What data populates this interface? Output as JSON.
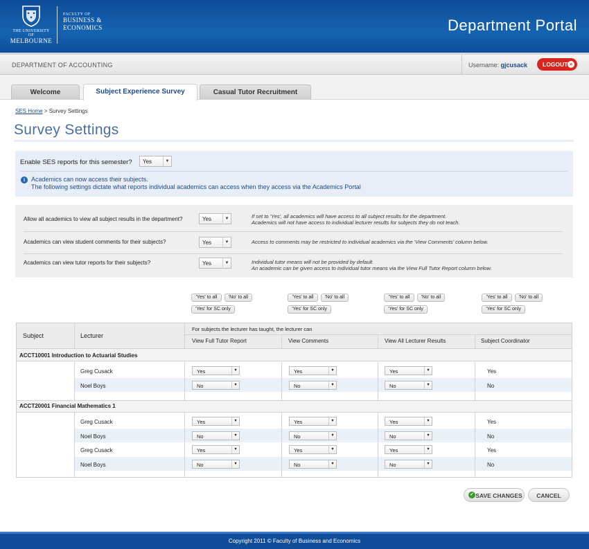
{
  "header": {
    "logo_sub": "THE UNIVERSITY OF",
    "logo_main": "MELBOURNE",
    "faculty_small": "FACULTY OF",
    "faculty_line1": "BUSINESS &",
    "faculty_line2": "ECONOMICS",
    "portal_title": "Department Portal"
  },
  "subbar": {
    "department": "DEPARTMENT OF ACCOUNTING",
    "username_label": "Username:",
    "username": "gjcusack",
    "logout_label": "LOGOUT"
  },
  "tabs": [
    {
      "label": "Welcome",
      "active": false
    },
    {
      "label": "Subject Experience Survey",
      "active": true
    },
    {
      "label": "Casual Tutor Recruitment",
      "active": false
    }
  ],
  "breadcrumb": {
    "home": "SES Home",
    "separator": " > ",
    "current": "Survey Settings"
  },
  "page_title": "Survey Settings",
  "enable": {
    "label": "Enable SES reports for this semester?",
    "value": "Yes",
    "info_line1": "Academics can now access their subjects.",
    "info_line2": "The following settings dictate what reports individual academics can access when they access via the Academics Portal"
  },
  "settings": [
    {
      "question": "Allow all academics to view all subject results in the department?",
      "value": "Yes",
      "note_line1": "If set to 'Yes', all academics will have access to all subject results for the department.",
      "note_line2": "Academics will not have access to individual lecturer results for subjects they do not teach."
    },
    {
      "question": "Academics can view student comments for their subjects?",
      "value": "Yes",
      "note_line1": "Access to comments may be restricted to individual academics via the 'View Comments' column below.",
      "note_line2": ""
    },
    {
      "question": "Academics can view tutor reports for their subjects?",
      "value": "Yes",
      "note_line1": "Individual tutor means will not be provided by default.",
      "note_line2": "An academic can be given access to individual tutor means via the View Full Tutor Report column below."
    }
  ],
  "bulk": {
    "yes_all": "'Yes' to all",
    "no_all": "'No' to all",
    "yes_sc": "'Yes' for SC only"
  },
  "table": {
    "col_subject": "Subject",
    "col_lecturer": "Lecturer",
    "group_caption": "For subjects the lecturer has taught, the lecturer can",
    "col_tutor": "View Full Tutor Report",
    "col_comments": "View Comments",
    "col_results": "View All Lecturer Results",
    "col_coordinator": "Subject Coordinator",
    "subjects": [
      {
        "name": "ACCT10001 Introduction to Actuarial Studies",
        "rows": [
          {
            "lecturer": "Greg Cusack",
            "tutor": "Yes",
            "comments": "Yes",
            "results": "Yes",
            "coordinator": "Yes"
          },
          {
            "lecturer": "Noel Boys",
            "tutor": "No",
            "comments": "No",
            "results": "No",
            "coordinator": "No"
          }
        ]
      },
      {
        "name": "ACCT20001 Financial Mathematics 1",
        "rows": [
          {
            "lecturer": "Greg Cusack",
            "tutor": "Yes",
            "comments": "Yes",
            "results": "Yes",
            "coordinator": "Yes"
          },
          {
            "lecturer": "Noel Boys",
            "tutor": "No",
            "comments": "No",
            "results": "No",
            "coordinator": "No"
          },
          {
            "lecturer": "Greg Cusack",
            "tutor": "Yes",
            "comments": "Yes",
            "results": "Yes",
            "coordinator": "Yes"
          },
          {
            "lecturer": "Noel Boys",
            "tutor": "No",
            "comments": "No",
            "results": "No",
            "coordinator": "No"
          }
        ]
      }
    ]
  },
  "actions": {
    "save": "SAVE CHANGES",
    "cancel": "CANCEL"
  },
  "footer": "Copyright 2011 © Faculty of Business and Economics",
  "colors": {
    "header_blue": "#1563b0",
    "logout_red": "#d9261c",
    "link_blue": "#1f4a8a",
    "title_blue": "#4a6f9c"
  }
}
